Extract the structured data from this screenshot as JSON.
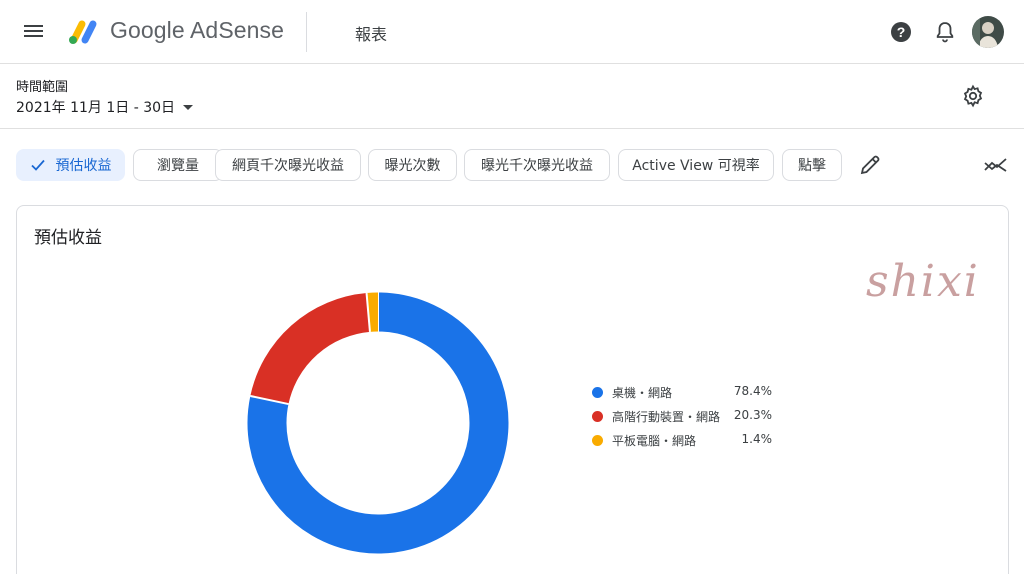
{
  "header": {
    "brand": "Google AdSense",
    "page_title": "報表",
    "icons": [
      "menu-icon",
      "adsense-logo",
      "help-icon",
      "bell-icon",
      "avatar"
    ]
  },
  "date_range": {
    "label": "時間範圍",
    "value": "2021年 11月 1日 - 30日"
  },
  "metric_chips": [
    {
      "label": "預估收益",
      "selected": true
    },
    {
      "label": "瀏覽量",
      "selected": false
    },
    {
      "label": "網頁千次曝光收益",
      "selected": false
    },
    {
      "label": "曝光次數",
      "selected": false
    },
    {
      "label": "曝光千次曝光收益",
      "selected": false
    },
    {
      "label": "Active View 可視率",
      "selected": false
    },
    {
      "label": "點擊",
      "selected": false
    }
  ],
  "card": {
    "title": "預估收益"
  },
  "chart_data": {
    "type": "pie",
    "title": "預估收益",
    "donut": true,
    "legend_position": "right",
    "categories": [
      "桌機・網路",
      "高階行動裝置・網路",
      "平板電腦・網路"
    ],
    "values": [
      78.4,
      20.3,
      1.4
    ],
    "value_labels": [
      "78.4%",
      "20.3%",
      "1.4%"
    ],
    "colors": [
      "#1a73e8",
      "#d93025",
      "#f9ab00"
    ]
  },
  "watermark": "shixi",
  "colors": {
    "accent": "#1a73e8",
    "chip_selected_bg": "#e8f0fe",
    "chip_selected_text": "#1967d2"
  }
}
